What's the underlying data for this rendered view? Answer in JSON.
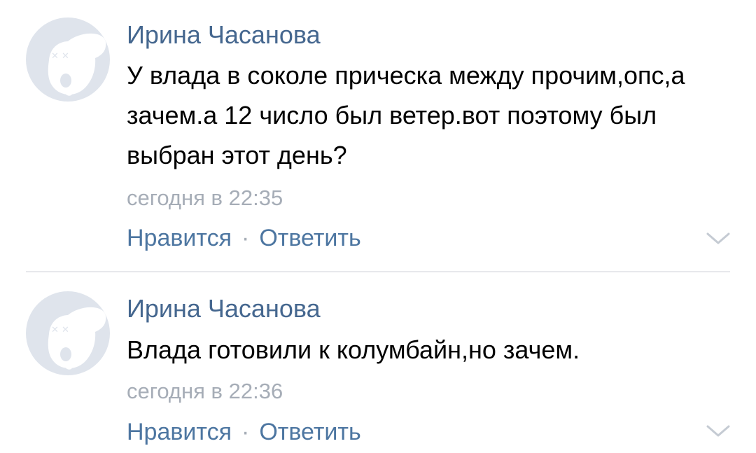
{
  "comments": [
    {
      "author": "Ирина Часанова",
      "text": "У влада в соколе прическа между прочим,опс,а зачем.а 12 число был ветер.вот поэтому был выбран этот день?",
      "time": "сегодня в 22:35",
      "like_label": "Нравится",
      "separator": "·",
      "reply_label": "Ответить",
      "avatar_icon": "deactivated-dog-icon",
      "menu_icon": "chevron-down-icon"
    },
    {
      "author": "Ирина Часанова",
      "text": "Влада готовили к колумбайн,но зачем.",
      "time": "сегодня в 22:36",
      "like_label": "Нравится",
      "separator": "·",
      "reply_label": "Ответить",
      "avatar_icon": "deactivated-dog-icon",
      "menu_icon": "chevron-down-icon"
    }
  ],
  "colors": {
    "author": "#45678f",
    "action": "#4d76a1",
    "meta": "#a6adb7",
    "avatar_bg": "#dfe4ec",
    "divider": "#e7e8ec"
  }
}
